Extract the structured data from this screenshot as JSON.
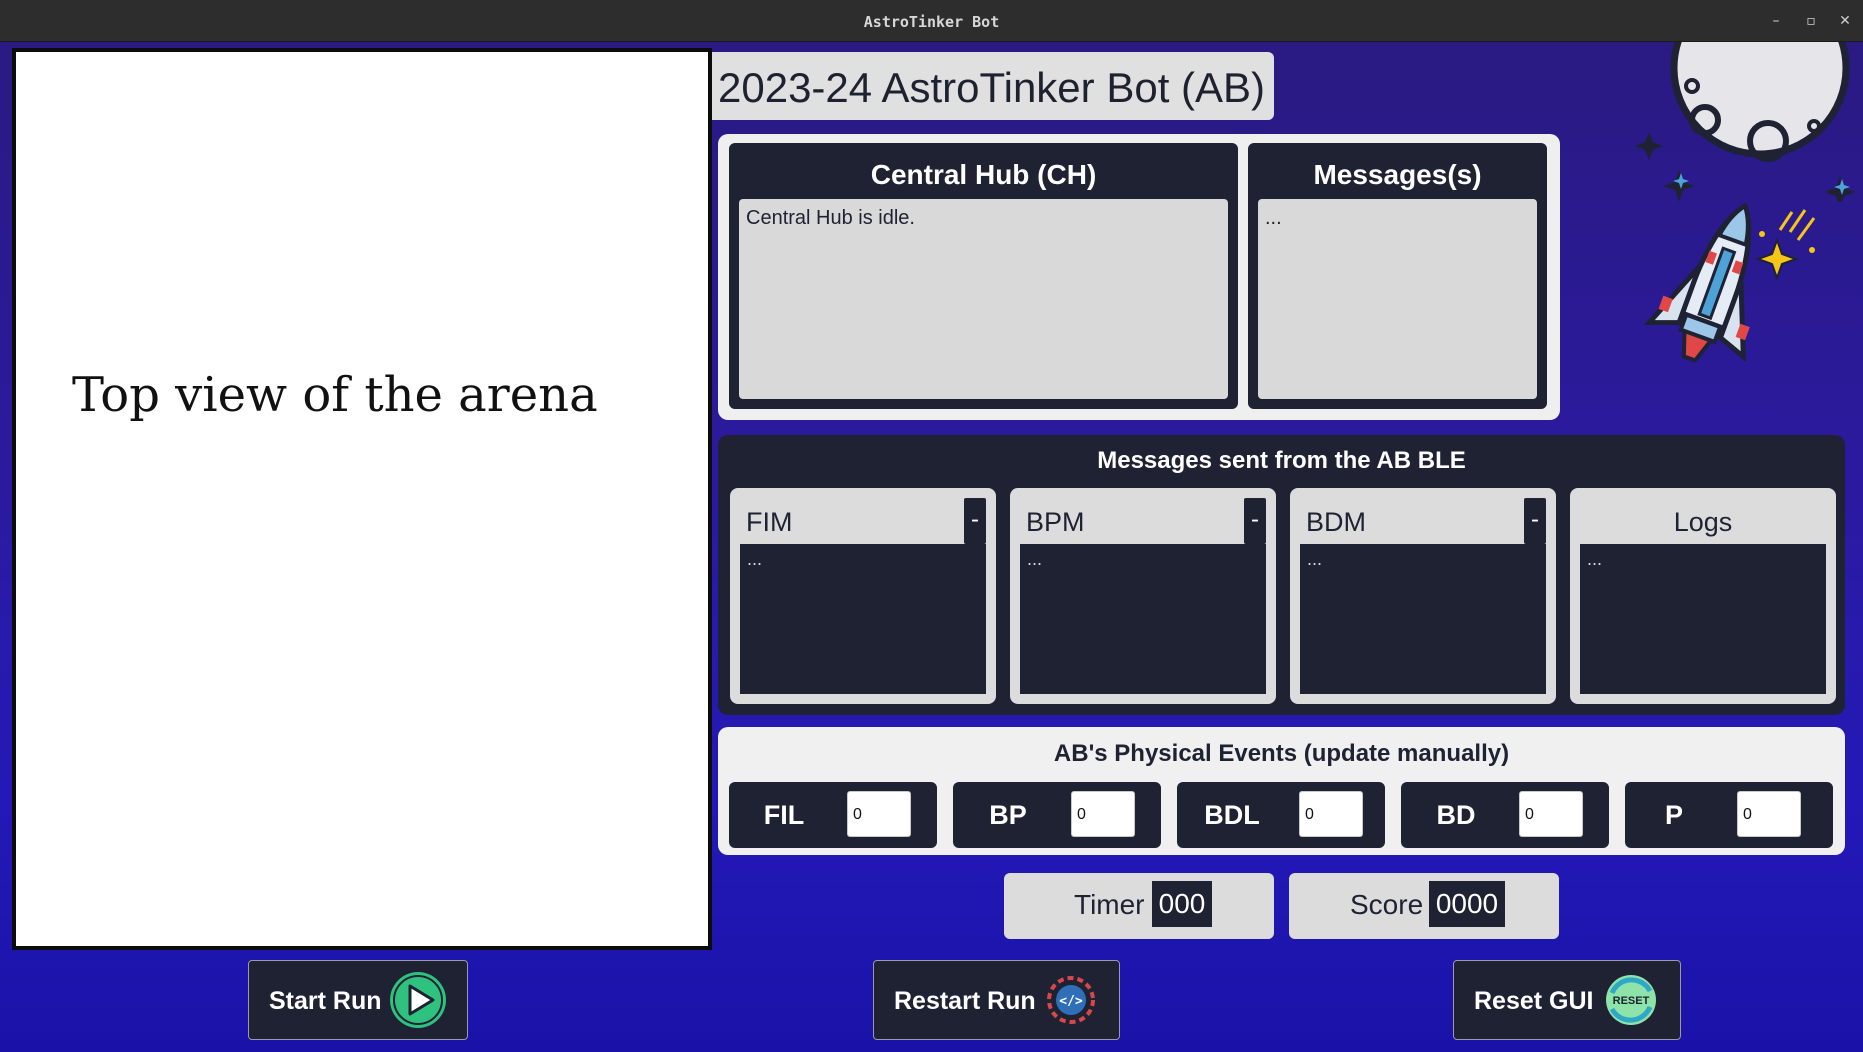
{
  "window": {
    "title": "AstroTinker Bot"
  },
  "arena": {
    "label": "Top view of the arena"
  },
  "app_title": "2023-24 AstroTinker Bot (AB)",
  "central_hub": {
    "title": "Central Hub (CH)",
    "text": "Central Hub is idle."
  },
  "messages_panel": {
    "title": "Messages(s)",
    "text": "..."
  },
  "ble": {
    "title": "Messages sent from the AB BLE",
    "cards": [
      {
        "label": "FIM",
        "text": "...",
        "toggle": "-"
      },
      {
        "label": "BPM",
        "text": "...",
        "toggle": "-"
      },
      {
        "label": "BDM",
        "text": "...",
        "toggle": "-"
      },
      {
        "label": "Logs",
        "text": "..."
      }
    ]
  },
  "events": {
    "title": "AB's Physical Events (update manually)",
    "items": [
      {
        "label": "FIL",
        "value": "0"
      },
      {
        "label": "BP",
        "value": "0"
      },
      {
        "label": "BDL",
        "value": "0"
      },
      {
        "label": "BD",
        "value": "0"
      },
      {
        "label": "P",
        "value": "0"
      }
    ]
  },
  "timer": {
    "label": "Timer",
    "value": "000"
  },
  "score": {
    "label": "Score",
    "value": "0000"
  },
  "buttons": {
    "start": "Start Run",
    "restart": "Restart Run",
    "reset": "Reset GUI",
    "reset_icon_text": "RESET"
  },
  "colors": {
    "panel_dark": "#1e2233",
    "panel_light": "#dcdcdc",
    "background": "#2b1aa0",
    "accent_green": "#2ec27e"
  }
}
